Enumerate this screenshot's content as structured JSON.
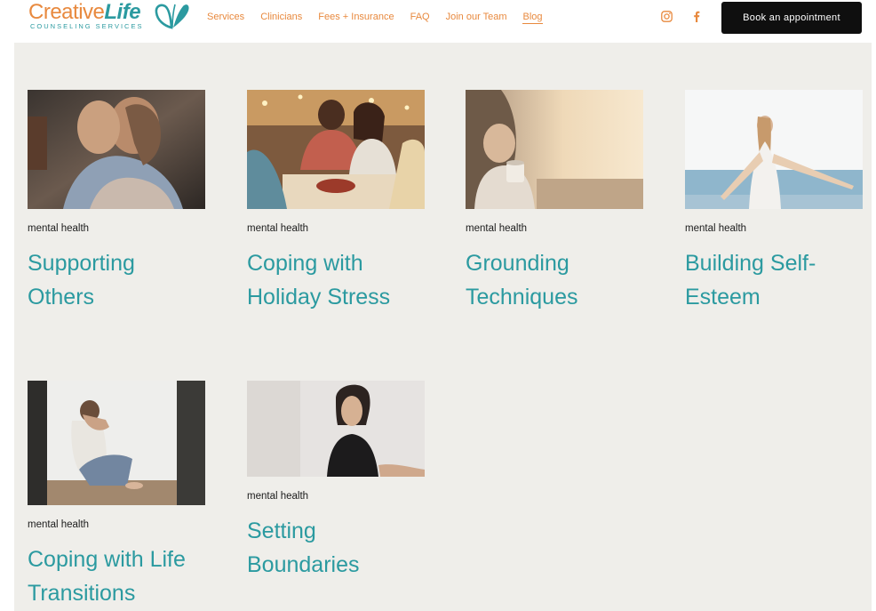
{
  "brand": {
    "name_part1": "Creative",
    "name_part2": "Life",
    "tagline": "COUNSELING SERVICES"
  },
  "nav": {
    "items": [
      {
        "label": "Services"
      },
      {
        "label": "Clinicians"
      },
      {
        "label": "Fees + Insurance"
      },
      {
        "label": "FAQ"
      },
      {
        "label": "Join our Team"
      },
      {
        "label": "Blog",
        "active": true
      }
    ]
  },
  "social": {
    "instagram_icon": "instagram-icon",
    "facebook_icon": "facebook-icon"
  },
  "cta": {
    "label": "Book an appointment"
  },
  "colors": {
    "accent_orange": "#e8893e",
    "accent_teal": "#2b9aa0",
    "background": "#efeeea",
    "button_bg": "#0f0f0f"
  },
  "posts": [
    {
      "category": "mental health",
      "title": "Supporting Others",
      "image": "two-people-hugging-photo"
    },
    {
      "category": "mental health",
      "title": "Coping with Holiday Stress",
      "image": "friends-holiday-dinner-photo"
    },
    {
      "category": "mental health",
      "title": "Grounding Techniques",
      "image": "woman-holding-mug-sunset-photo"
    },
    {
      "category": "mental health",
      "title": "Building Self-Esteem",
      "image": "woman-arms-open-sea-photo"
    },
    {
      "category": "mental health",
      "title": "Coping with Life Transitions",
      "image": "man-sitting-head-in-hands-photo"
    },
    {
      "category": "mental health",
      "title": "Setting Boundaries",
      "image": "woman-looking-away-photo"
    }
  ]
}
